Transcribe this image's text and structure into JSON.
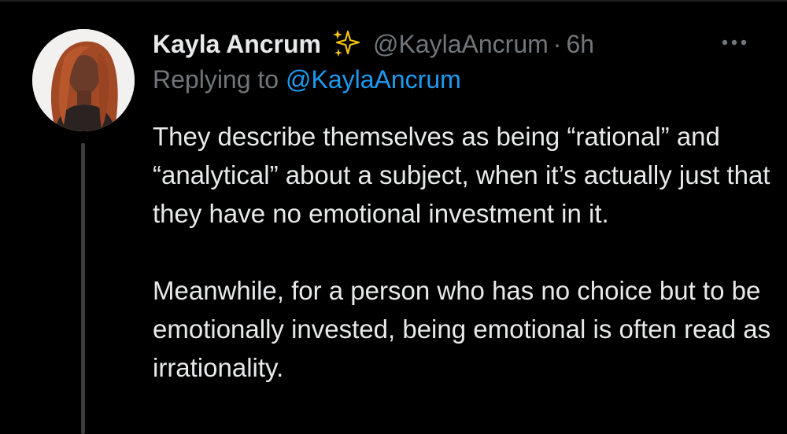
{
  "tweet": {
    "display_name": "Kayla Ancrum",
    "handle": "@KaylaAncrum",
    "separator": "·",
    "timestamp": "6h",
    "reply_prefix": "Replying to",
    "reply_to": "@KaylaAncrum",
    "paragraphs": [
      "They describe themselves as being “rational” and “analytical” about a subject, when it’s actually just that they have no emotional investment in it.",
      "Meanwhile, for a person who has no choice but to be emotionally invested, being emotional is often read as irrationality."
    ]
  },
  "icons": {
    "name_badge": "sparkles-icon",
    "menu": "more-options-icon",
    "profile": "avatar"
  },
  "colors": {
    "background": "#000000",
    "text_primary": "#e7e9ea",
    "text_secondary": "#71767b",
    "link": "#1d9bf0",
    "thread_line": "#3a3d40"
  }
}
